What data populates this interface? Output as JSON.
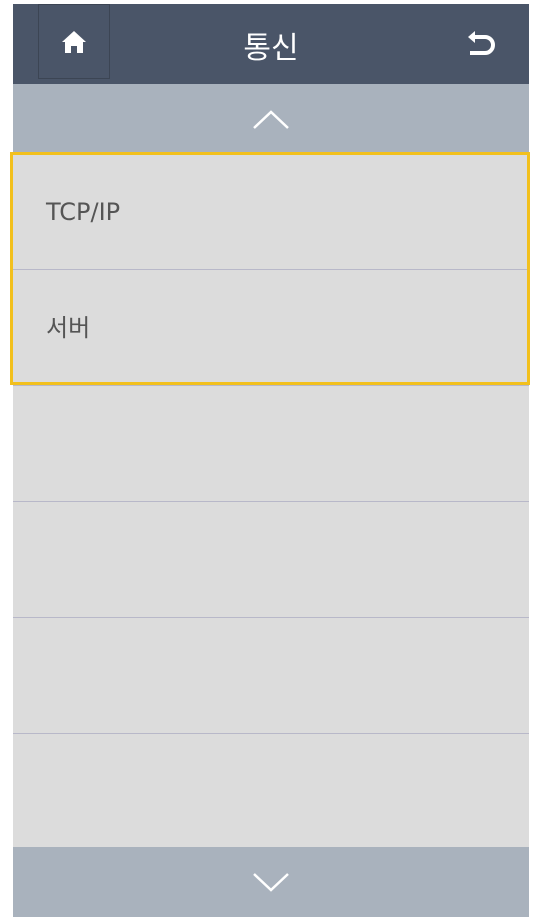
{
  "header": {
    "title": "통신",
    "home_icon": "home-icon",
    "back_icon": "back-arrow-icon"
  },
  "menu": {
    "items": [
      {
        "label": "TCP/IP"
      },
      {
        "label": "서버"
      },
      {
        "label": ""
      },
      {
        "label": ""
      },
      {
        "label": ""
      },
      {
        "label": ""
      }
    ],
    "selected_indices": [
      0,
      1
    ]
  },
  "scroll": {
    "up_icon": "chevron-up-icon",
    "down_icon": "chevron-down-icon"
  },
  "colors": {
    "header_bg": "#4a5568",
    "scroll_bar_bg": "#a9b2bd",
    "list_bg": "#dcdcdc",
    "highlight_border": "#f2c01d",
    "divider": "#b8b8c9"
  }
}
